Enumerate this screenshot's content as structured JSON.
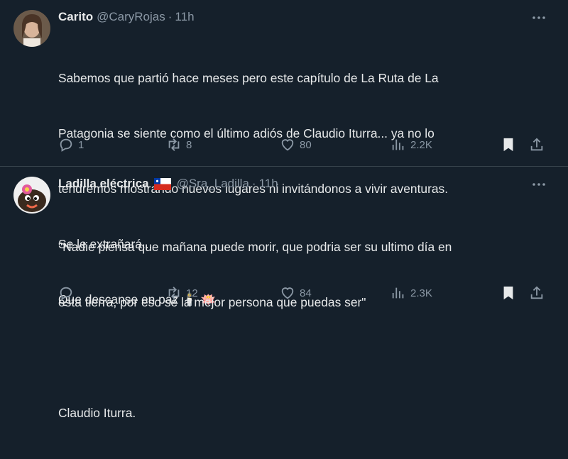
{
  "tweets": [
    {
      "name": "Carito",
      "handle": "@CaryRojas",
      "sep": "·",
      "time": "11h",
      "text_lines": [
        "Sabemos que partió hace meses pero este capítulo de La Ruta de La",
        "Patagonia se siente como el último adiós de Claudio Iturra... ya no lo",
        "tendremos mostrando nuevos lugares ni invitándonos a vivir aventuras.",
        "Se le extrañará...",
        "Que descanse en paz 🕯️ 🪷"
      ],
      "stats": {
        "replies": "1",
        "retweets": "8",
        "likes": "80",
        "views": "2.2K"
      }
    },
    {
      "name": "Ladilla eléctrica",
      "flag": "chile-flag",
      "handle": "@Sra_Ladilla",
      "sep": "·",
      "time": "11h",
      "text_lines": [
        "\"Nadie piensa que mañana puede morir, que podria ser su ultimo día en",
        "esta tierra, por eso sé la mejor persona que puedas ser\"",
        "",
        "Claudio Iturra."
      ],
      "stats": {
        "replies": "",
        "retweets": "12",
        "likes": "84",
        "views": "2.3K"
      }
    }
  ],
  "colors": {
    "background": "#15202b",
    "text": "#e7e9ea",
    "muted": "#8b98a5",
    "divider": "#38444d",
    "bookmark": "#e7e9ea"
  },
  "icons": [
    "more-icon",
    "reply-icon",
    "retweet-icon",
    "like-icon",
    "views-icon",
    "bookmark-icon",
    "share-icon"
  ]
}
